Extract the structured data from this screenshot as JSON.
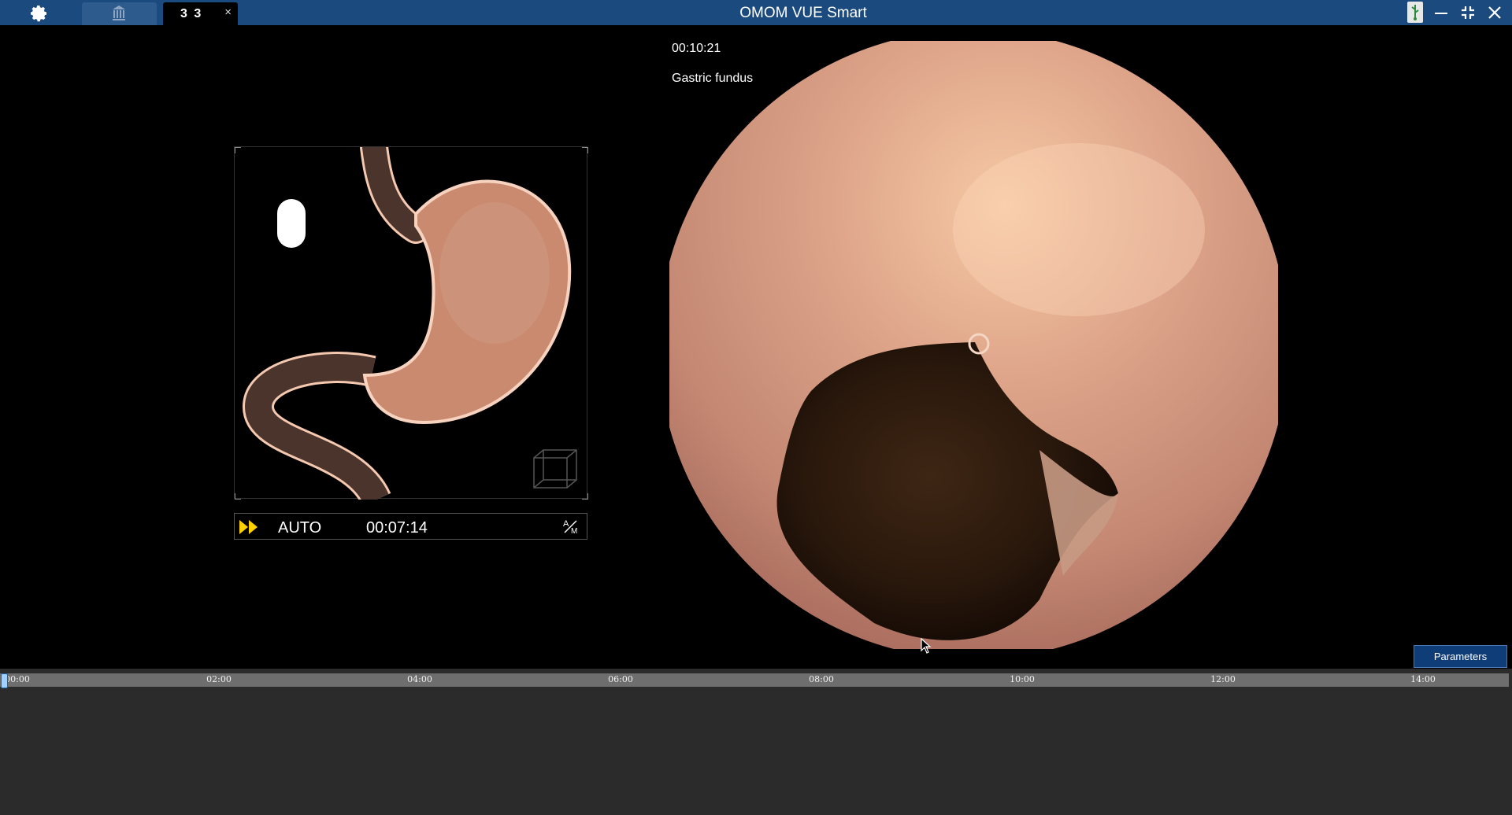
{
  "app": {
    "title": "OMOM VUE Smart"
  },
  "tabs": [
    {
      "kind": "home",
      "icon": "bank-icon"
    },
    {
      "label": "3 3",
      "close_label": "×",
      "active": true
    }
  ],
  "window_controls": [
    "minimize-icon",
    "restore-icon",
    "close-icon"
  ],
  "overlay": {
    "time": "00:10:21",
    "location": "Gastric fundus"
  },
  "model_panel": {
    "mode": "AUTO",
    "elapsed": "00:07:14",
    "mode_toggle": "A/M"
  },
  "parameters_label": "Parameters",
  "timeline": {
    "ticks": [
      "00:00",
      "02:00",
      "04:00",
      "06:00",
      "08:00",
      "10:00",
      "12:00",
      "14:00"
    ],
    "position": 0
  },
  "colors": {
    "titlebar": "#1b4a7e",
    "accent": "#0f3d78",
    "fast_forward": "#ffd000",
    "stomach": "#d08a6e"
  }
}
